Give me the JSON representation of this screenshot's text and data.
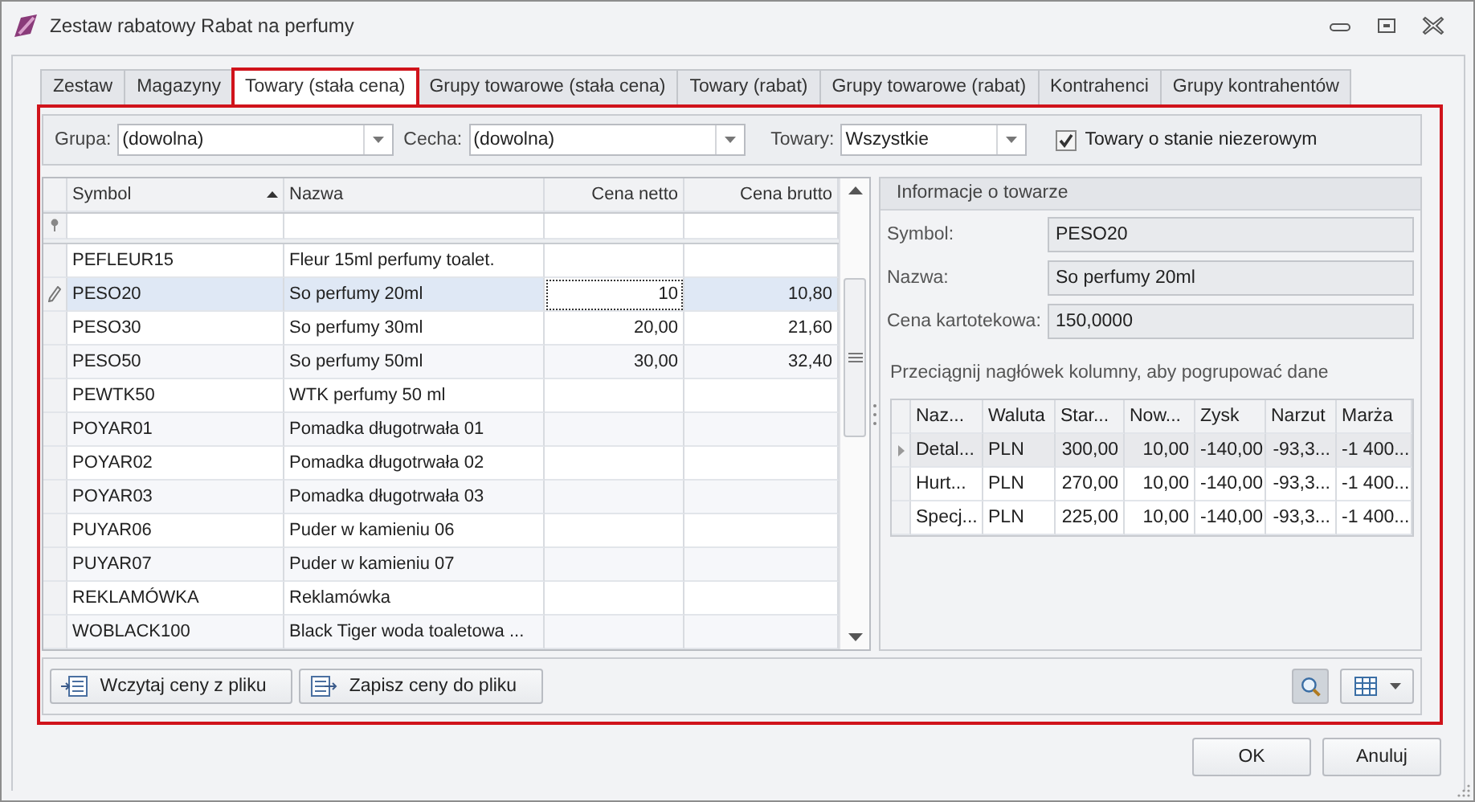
{
  "window": {
    "title": "Zestaw rabatowy Rabat na perfumy"
  },
  "tabs": [
    {
      "label": "Zestaw",
      "selected": false
    },
    {
      "label": "Magazyny",
      "selected": false
    },
    {
      "label": "Towary (stała cena)",
      "selected": true
    },
    {
      "label": "Grupy towarowe (stała cena)",
      "selected": false
    },
    {
      "label": "Towary (rabat)",
      "selected": false
    },
    {
      "label": "Grupy towarowe (rabat)",
      "selected": false
    },
    {
      "label": "Kontrahenci",
      "selected": false
    },
    {
      "label": "Grupy kontrahentów",
      "selected": false
    }
  ],
  "filters": {
    "grupa": {
      "label": "Grupa:",
      "value": "(dowolna)"
    },
    "cecha": {
      "label": "Cecha:",
      "value": "(dowolna)"
    },
    "towary": {
      "label": "Towary:",
      "value": "Wszystkie"
    },
    "nonzero": {
      "label": "Towary o stanie niezerowym",
      "checked": true
    }
  },
  "products": {
    "columns": [
      {
        "label": "Symbol",
        "sorted": true
      },
      {
        "label": "Nazwa",
        "sorted": false
      },
      {
        "label": "Cena netto",
        "sorted": false
      },
      {
        "label": "Cena brutto",
        "sorted": false
      }
    ],
    "rows": [
      {
        "symbol": "PEFLEUR15",
        "name": "Fleur 15ml perfumy toalet.",
        "net": "",
        "gross": "",
        "selected": false
      },
      {
        "symbol": "PESO20",
        "name": "So perfumy 20ml",
        "net": "10",
        "gross": "10,80",
        "selected": true
      },
      {
        "symbol": "PESO30",
        "name": "So perfumy 30ml",
        "net": "20,00",
        "gross": "21,60",
        "selected": false
      },
      {
        "symbol": "PESO50",
        "name": "So perfumy 50ml",
        "net": "30,00",
        "gross": "32,40",
        "selected": false
      },
      {
        "symbol": "PEWTK50",
        "name": "WTK perfumy 50 ml",
        "net": "",
        "gross": "",
        "selected": false
      },
      {
        "symbol": "POYAR01",
        "name": "Pomadka długotrwała 01",
        "net": "",
        "gross": "",
        "selected": false
      },
      {
        "symbol": "POYAR02",
        "name": "Pomadka długotrwała 02",
        "net": "",
        "gross": "",
        "selected": false
      },
      {
        "symbol": "POYAR03",
        "name": "Pomadka długotrwała 03",
        "net": "",
        "gross": "",
        "selected": false
      },
      {
        "symbol": "PUYAR06",
        "name": "Puder w kamieniu 06",
        "net": "",
        "gross": "",
        "selected": false
      },
      {
        "symbol": "PUYAR07",
        "name": "Puder w kamieniu 07",
        "net": "",
        "gross": "",
        "selected": false
      },
      {
        "symbol": "REKLAMÓWKA",
        "name": "Reklamówka",
        "net": "",
        "gross": "",
        "selected": false
      },
      {
        "symbol": "WOBLACK100",
        "name": "Black Tiger woda toaletowa ...",
        "net": "",
        "gross": "",
        "selected": false
      }
    ]
  },
  "info": {
    "title": "Informacje o towarze",
    "fields": [
      {
        "label": "Symbol:",
        "value": "PESO20"
      },
      {
        "label": "Nazwa:",
        "value": "So perfumy 20ml"
      },
      {
        "label": "Cena kartotekowa:",
        "value": "150,0000"
      }
    ],
    "group_hint": "Przeciągnij nagłówek kolumny, aby pogrupować dane",
    "columns": [
      "Naz...",
      "Waluta",
      "Star...",
      "Now...",
      "Zysk",
      "Narzut",
      "Marża"
    ],
    "rows": [
      {
        "cells": [
          "Detal...",
          "PLN",
          "300,00",
          "10,00",
          "-140,00",
          "-93,3...",
          "-1 400..."
        ],
        "selected": true
      },
      {
        "cells": [
          "Hurt...",
          "PLN",
          "270,00",
          "10,00",
          "-140,00",
          "-93,3...",
          "-1 400..."
        ],
        "selected": false
      },
      {
        "cells": [
          "Specj...",
          "PLN",
          "225,00",
          "10,00",
          "-140,00",
          "-93,3...",
          "-1 400..."
        ],
        "selected": false
      }
    ]
  },
  "toolbar": [
    {
      "kind": "import",
      "label": "Wczytaj ceny z pliku"
    },
    {
      "kind": "export",
      "label": "Zapisz ceny do pliku"
    }
  ],
  "dialog_buttons": [
    "OK",
    "Anuluj"
  ]
}
